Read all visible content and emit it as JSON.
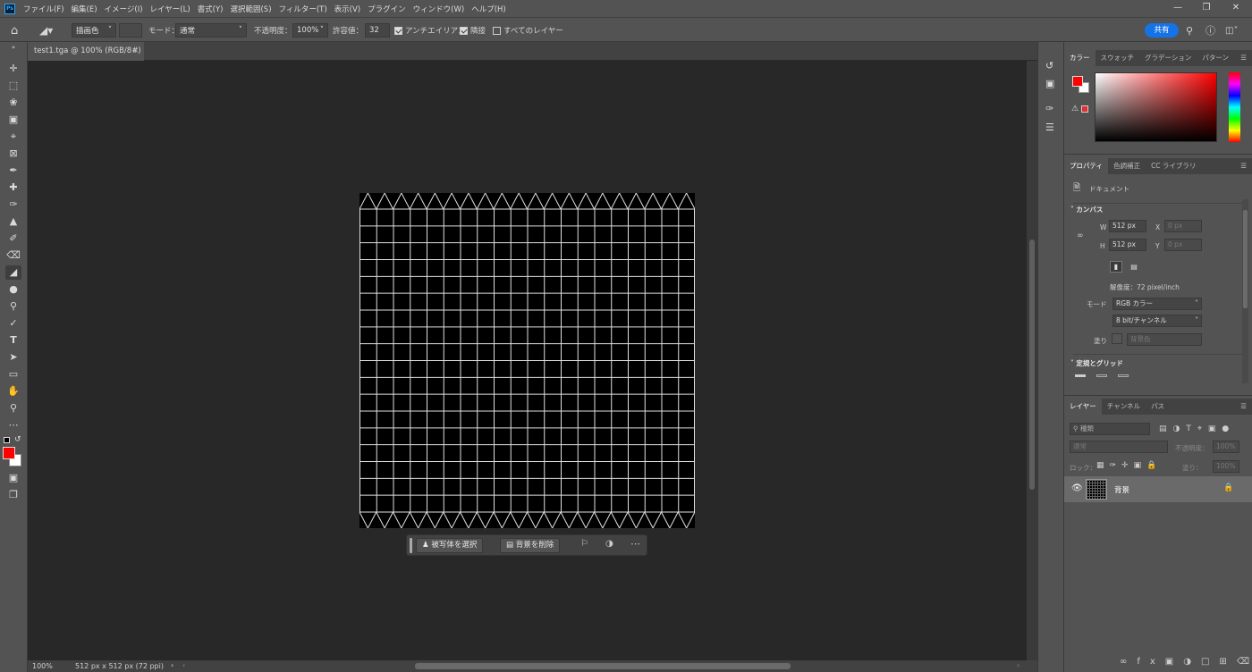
{
  "app": {
    "logo": "Ps"
  },
  "menu": [
    "ファイル(F)",
    "編集(E)",
    "イメージ(I)",
    "レイヤー(L)",
    "書式(Y)",
    "選択範囲(S)",
    "フィルター(T)",
    "表示(V)",
    "プラグイン",
    "ウィンドウ(W)",
    "ヘルプ(H)"
  ],
  "options": {
    "fill_source": "描画色",
    "mode_label": "モード：",
    "mode_value": "通常",
    "opacity_label": "不透明度：",
    "opacity_value": "100%",
    "tolerance_label": "許容値：",
    "tolerance_value": "32",
    "antialias_label": "アンチエイリアス",
    "contiguous_label": "隣接",
    "all_layers_label": "すべてのレイヤー",
    "share_label": "共有"
  },
  "document": {
    "tab_title": "test1.tga @ 100% (RGB/8#)",
    "zoom": "100%",
    "size_info": "512 px x 512 px (72 ppi)"
  },
  "canvas": {
    "grid_columns": 20,
    "grid_rows": 18,
    "background": "#000000",
    "line_color": "#e0e0e0"
  },
  "context_bar": {
    "select_subject": "被写体を選択",
    "remove_bg": "背景を削除"
  },
  "color_panel": {
    "tabs": [
      "カラー",
      "スウォッチ",
      "グラデーション",
      "パターン"
    ],
    "foreground": "#ff0000",
    "background": "#ffffff"
  },
  "properties": {
    "tabs": [
      "プロパティ",
      "色調補正",
      "CC ライブラリ"
    ],
    "doc_label": "ドキュメント",
    "canvas_section": "カンバス",
    "w_label": "W",
    "w_value": "512 px",
    "h_label": "H",
    "h_value": "512 px",
    "x_label": "X",
    "x_placeholder": "0 px",
    "y_label": "Y",
    "y_placeholder": "0 px",
    "resolution": "解像度：72 pixel/inch",
    "mode_label": "モード",
    "mode_value": "RGB カラー",
    "depth_value": "8 bit/チャンネル",
    "fill_label": "塗り",
    "fill_value": "背景色",
    "guides_section": "定規とグリッド"
  },
  "layers": {
    "tabs": [
      "レイヤー",
      "チャンネル",
      "パス"
    ],
    "search_placeholder": "種類",
    "blend_mode": "通常",
    "opacity_label": "不透明度：",
    "opacity_value": "100%",
    "lock_label": "ロック：",
    "fill_label": "塗り：",
    "fill_value": "100%",
    "items": [
      {
        "name": "背景"
      }
    ]
  }
}
